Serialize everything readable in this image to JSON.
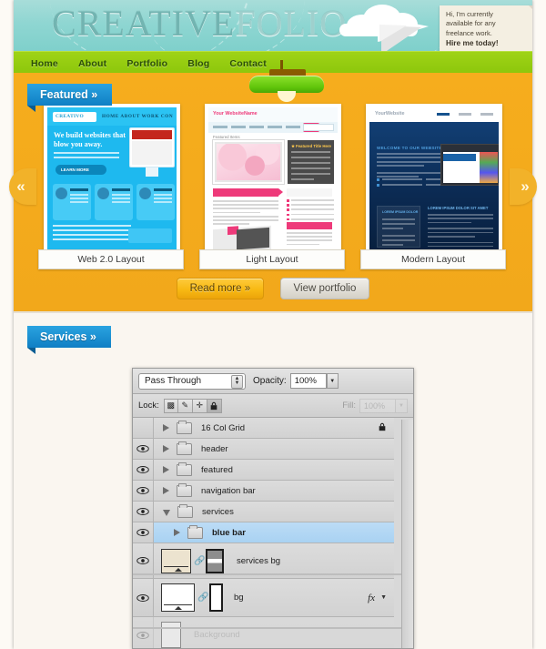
{
  "site": {
    "logo_part1": "CREATIVE",
    "logo_part2": "FOLIO",
    "note_line1": "Hi, I'm currently",
    "note_line2": "available for any",
    "note_line3": "freelance work.",
    "note_cta": "Hire me today!"
  },
  "nav": {
    "items": [
      {
        "label": "Home"
      },
      {
        "label": "About"
      },
      {
        "label": "Portfolio"
      },
      {
        "label": "Blog"
      },
      {
        "label": "Contact"
      }
    ]
  },
  "featured": {
    "ribbon": "Featured »",
    "prev_arrow": "«",
    "next_arrow": "»",
    "items": [
      {
        "caption": "Web 2.0 Layout"
      },
      {
        "caption": "Light Layout"
      },
      {
        "caption": "Modern Layout"
      }
    ],
    "read_more": "Read more »",
    "view_portfolio": "View portfolio",
    "mini1": {
      "logo": "CREATIVO",
      "nav": "HOME  ABOUT  WORK  CON",
      "headline": "We build websites that blow you away.",
      "cta": "LEARN MORE"
    },
    "mini2": {
      "brand_a": "Your ",
      "brand_b": "WebsiteName",
      "section_label": "Featured Items"
    },
    "mini3": {
      "brand_a": "Your",
      "brand_b": "Website",
      "heading_a": "WELCOME TO ",
      "heading_b": "OUR WEBSITE",
      "col_heading_a": "LOREM IPSUM ",
      "col_heading_b": "DOLOR SIT AMET",
      "box_heading": "LOREM IPSUM DOLOR"
    }
  },
  "services": {
    "ribbon": "Services »"
  },
  "photoshop": {
    "blend_mode": "Pass Through",
    "opacity_label": "Opacity:",
    "opacity_value": "100%",
    "lock_label": "Lock:",
    "lock_buttons": [
      {
        "name": "lock-transparent-pixels",
        "glyph": "▨",
        "active": false
      },
      {
        "name": "lock-image-pixels",
        "glyph": "✎",
        "active": false
      },
      {
        "name": "lock-position",
        "glyph": "✛",
        "active": false
      },
      {
        "name": "lock-all",
        "glyph": "🔒",
        "active": true
      }
    ],
    "fill_label": "Fill:",
    "fill_value": "100%",
    "layers": [
      {
        "name": "16 Col Grid",
        "visible": false,
        "expanded": false,
        "type": "group",
        "locked": true,
        "selected": false,
        "bold": false
      },
      {
        "name": "header",
        "visible": true,
        "expanded": false,
        "type": "group",
        "locked": false,
        "selected": false,
        "bold": false
      },
      {
        "name": "featured",
        "visible": true,
        "expanded": false,
        "type": "group",
        "locked": false,
        "selected": false,
        "bold": false
      },
      {
        "name": "navigation bar",
        "visible": true,
        "expanded": false,
        "type": "group",
        "locked": false,
        "selected": false,
        "bold": false
      },
      {
        "name": "services",
        "visible": true,
        "expanded": true,
        "type": "group",
        "locked": false,
        "selected": false,
        "bold": false
      },
      {
        "name": "blue bar",
        "visible": true,
        "expanded": false,
        "type": "group",
        "locked": false,
        "selected": true,
        "bold": true,
        "indent": true
      },
      {
        "name": "services bg",
        "visible": true,
        "expanded": false,
        "type": "layer",
        "locked": false,
        "selected": false,
        "bold": false
      },
      {
        "name": "bg",
        "visible": true,
        "expanded": false,
        "type": "layer",
        "locked": false,
        "selected": false,
        "bold": false,
        "fx": "fx"
      },
      {
        "name": "Background",
        "visible": false,
        "expanded": false,
        "type": "background",
        "locked": false,
        "selected": false,
        "bold": false
      }
    ]
  },
  "colors": {
    "sky": "#8fd6d2",
    "nav_green": "#9fd316",
    "featured_orange": "#f6ad1d",
    "ribbon_blue": "#1288c9",
    "services_bg": "#faf6f0",
    "panel_gray": "#d4d4d4",
    "selection_blue": "#b0d6f4"
  }
}
